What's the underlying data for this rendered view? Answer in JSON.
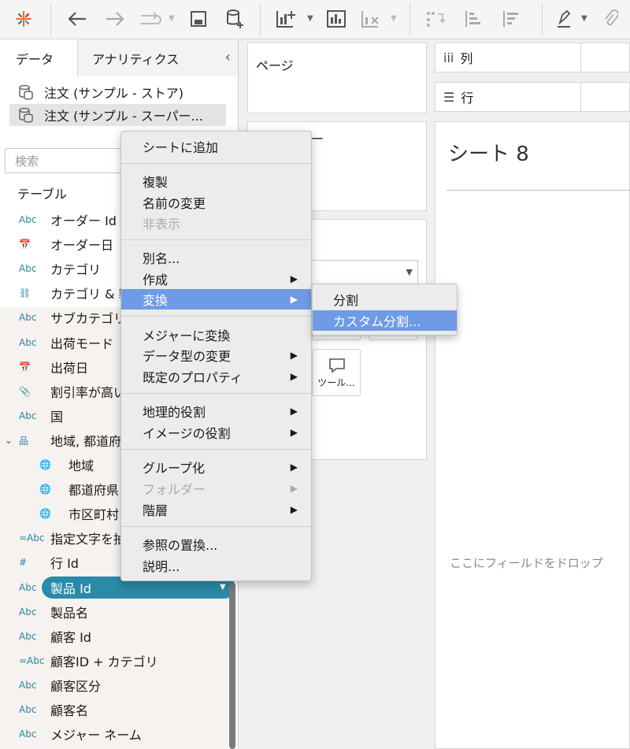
{
  "toolbar": {
    "icons": [
      "tableau-logo-icon",
      "undo-icon",
      "redo-icon",
      "replay-icon",
      "save-icon",
      "new-datasource-icon",
      "new-worksheet-icon",
      "new-dashboard-icon",
      "clear-sheet-icon",
      "swap-icon",
      "sort-ascending-icon",
      "sort-descending-icon",
      "highlight-icon",
      "attach-icon"
    ]
  },
  "data_pane": {
    "tab_data": "データ",
    "tab_analytics": "アナリティクス",
    "collapse": "‹",
    "sources": [
      "注文 (サンプル - ストア)",
      "注文 (サンプル - スーパー..."
    ],
    "search_placeholder": "検索",
    "section_title": "テーブル",
    "fields": [
      {
        "icon": "Abc",
        "name": "オーダー Id"
      },
      {
        "icon": "📅",
        "name": "オーダー日"
      },
      {
        "icon": "Abc",
        "name": "カテゴリ"
      },
      {
        "icon": "⛓",
        "name": "カテゴリ & 製"
      },
      {
        "icon": "Abc",
        "name": "サブカテゴリ"
      },
      {
        "icon": "Abc",
        "name": "出荷モード"
      },
      {
        "icon": "📅",
        "name": "出荷日"
      },
      {
        "icon": "📎",
        "name": "割引率が高い"
      },
      {
        "icon": "Abc",
        "name": "国"
      },
      {
        "icon": "品",
        "name": "地域, 都道府"
      },
      {
        "icon": "🌐",
        "name": "地域"
      },
      {
        "icon": "🌐",
        "name": "都道府県"
      },
      {
        "icon": "🌐",
        "name": "市区町村"
      },
      {
        "icon": "=Abc",
        "name": "指定文字を抽"
      },
      {
        "icon": "#",
        "name": "行 Id"
      },
      {
        "icon": "Abc",
        "name": "製品 Id"
      },
      {
        "icon": "Abc",
        "name": "製品名"
      },
      {
        "icon": "Abc",
        "name": "顧客 Id"
      },
      {
        "icon": "=Abc",
        "name": "顧客ID + カテゴリ"
      },
      {
        "icon": "Abc",
        "name": "顧客区分"
      },
      {
        "icon": "Abc",
        "name": "顧客名"
      },
      {
        "icon": "Abc",
        "name": "メジャー ネーム"
      }
    ],
    "selected_field": "製品 Id"
  },
  "middle": {
    "pages_title": "ページ",
    "filters_title_fragment": "ー",
    "tooltip_label": "ツール..."
  },
  "right": {
    "columns_icon": "iii",
    "columns_label": "列",
    "rows_icon": "☰",
    "rows_label": "行",
    "sheet_title": "シート 8",
    "drop_hint": "ここにフィールドをドロップ"
  },
  "context_menu": {
    "items": [
      {
        "label": "シートに追加"
      },
      {
        "label": "複製"
      },
      {
        "label": "名前の変更"
      },
      {
        "label": "非表示"
      },
      {
        "label": "別名..."
      },
      {
        "label": "作成"
      },
      {
        "label": "変換"
      },
      {
        "label": "メジャーに変換"
      },
      {
        "label": "データ型の変更"
      },
      {
        "label": "既定のプロパティ"
      },
      {
        "label": "地理的役割"
      },
      {
        "label": "イメージの役割"
      },
      {
        "label": "グループ化"
      },
      {
        "label": "フォルダー"
      },
      {
        "label": "階層"
      },
      {
        "label": "参照の置換..."
      },
      {
        "label": "説明..."
      }
    ],
    "arrow": "▶"
  },
  "submenu": {
    "items": [
      {
        "label": "分割"
      },
      {
        "label": "カスタム分割..."
      }
    ]
  },
  "colors": {
    "menu_highlight": "#6f9be6",
    "selected_pill": "#2a8aa8",
    "field_icon": "#2b84a8"
  }
}
